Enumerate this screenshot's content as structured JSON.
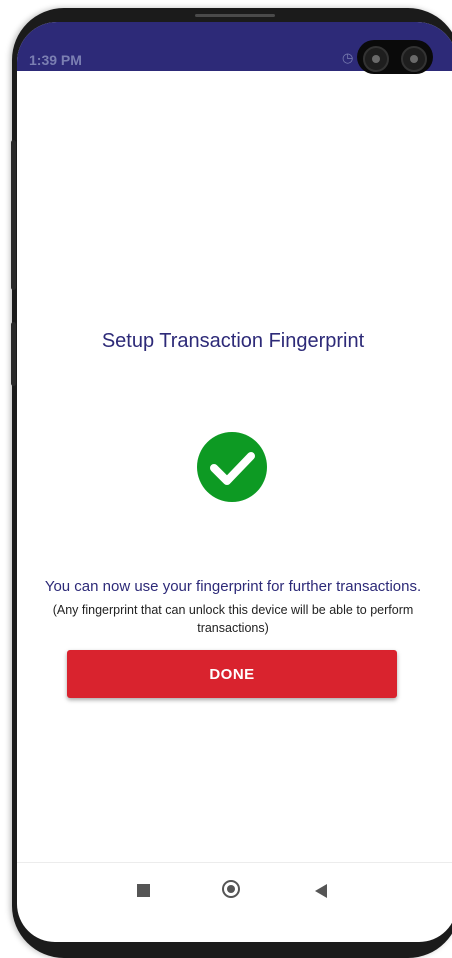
{
  "status_bar": {
    "time": "1:39 PM",
    "icons": [
      "alarm-icon",
      "signal-icon"
    ]
  },
  "screen": {
    "title": "Setup Transaction Fingerprint",
    "success_icon": "check-circle-icon",
    "message": "You can now use your fingerprint for further transactions.",
    "note": "(Any fingerprint that can unlock this device will be able to perform transactions)",
    "done_label": "DONE"
  },
  "nav_bar": {
    "items": [
      "recents-square-icon",
      "home-circle-icon",
      "back-triangle-icon"
    ]
  },
  "colors": {
    "status_bar": "#2d2a78",
    "title_text": "#2d2a78",
    "success_green": "#0d9a23",
    "done_button": "#d9232e"
  }
}
